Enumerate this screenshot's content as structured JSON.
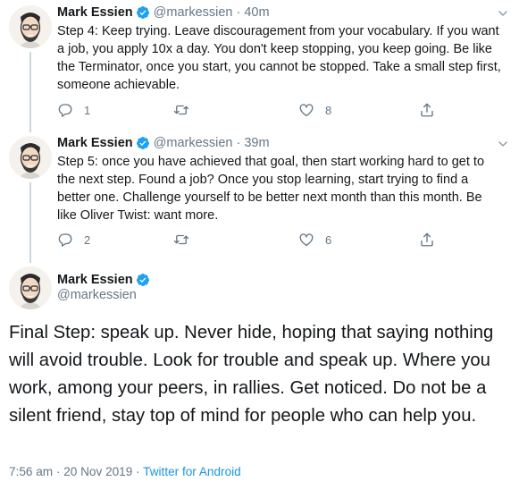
{
  "colors": {
    "verified": "#1da1f2",
    "muted": "#657786",
    "link": "#1b95e0",
    "line": "#ccd6dd"
  },
  "tweets": [
    {
      "name": "Mark Essien",
      "handle": "@markessien",
      "separator": "·",
      "time": "40m",
      "text": "Step 4: Keep trying. Leave discouragement from your vocabulary. If you want a job, you apply 10x a day. You don't keep stopping, you keep going. Be like the Terminator, once you start, you cannot be stopped. Take a small step first, someone achievable.",
      "replies": "1",
      "likes": "8"
    },
    {
      "name": "Mark Essien",
      "handle": "@markessien",
      "separator": "·",
      "time": "39m",
      "text": "Step 5: once you have achieved that goal, then start working hard to get to the next step. Found a job? Once you stop learning, start trying to find a better one. Challenge yourself to be better next month than this month. Be like Oliver Twist: want more.",
      "replies": "2",
      "likes": "6"
    }
  ],
  "final": {
    "name": "Mark Essien",
    "handle": "@markessien",
    "text": "Final Step: speak up. Never hide, hoping that saying nothing will avoid trouble. Look for trouble and speak up. Where you work, among your peers, in rallies. Get noticed. Do not be a silent friend, stay top of mind for people who can help you.",
    "time": "7:56 am",
    "separator": "·",
    "date": "20 Nov 2019",
    "app": "Twitter for Android"
  },
  "icons": [
    "verified-icon",
    "reply-icon",
    "retweet-icon",
    "like-icon",
    "share-icon",
    "chevron-down-icon",
    "avatar"
  ]
}
